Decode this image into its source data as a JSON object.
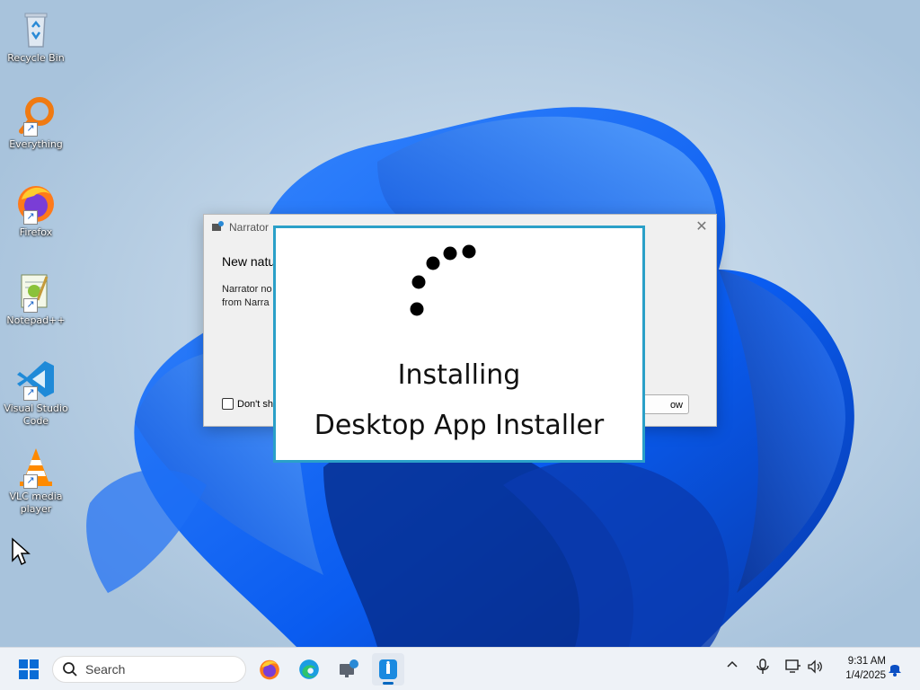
{
  "desktop_icons": [
    {
      "label": "Recycle Bin",
      "icon": "recycle-bin-icon"
    },
    {
      "label": "Everything",
      "icon": "everything-search-icon"
    },
    {
      "label": "Firefox",
      "icon": "firefox-icon"
    },
    {
      "label": "Notepad++",
      "icon": "notepad-plus-plus-icon"
    },
    {
      "label": "Visual Studio Code",
      "icon": "vscode-icon"
    },
    {
      "label": "VLC media player",
      "icon": "vlc-icon"
    }
  ],
  "narrator_dialog": {
    "title": "Narrator",
    "heading": "New natu",
    "body_line1": "Narrator no",
    "body_line2": "from Narra",
    "checkbox_label": "Don't sh",
    "button_label": "ow",
    "close_glyph": "✕"
  },
  "install_panel": {
    "status": "Installing",
    "app_name": "Desktop App Installer",
    "border_color": "#2aa0c8"
  },
  "taskbar": {
    "search_placeholder": "Search",
    "pinned": [
      "firefox-icon",
      "edge-icon",
      "narrator-icon",
      "app-installer-icon"
    ],
    "active_app": "app-installer-icon",
    "accent_color": "#0067c0"
  },
  "tray": {
    "chevron": "^",
    "time": "9:31 AM",
    "date": "1/4/2025"
  }
}
